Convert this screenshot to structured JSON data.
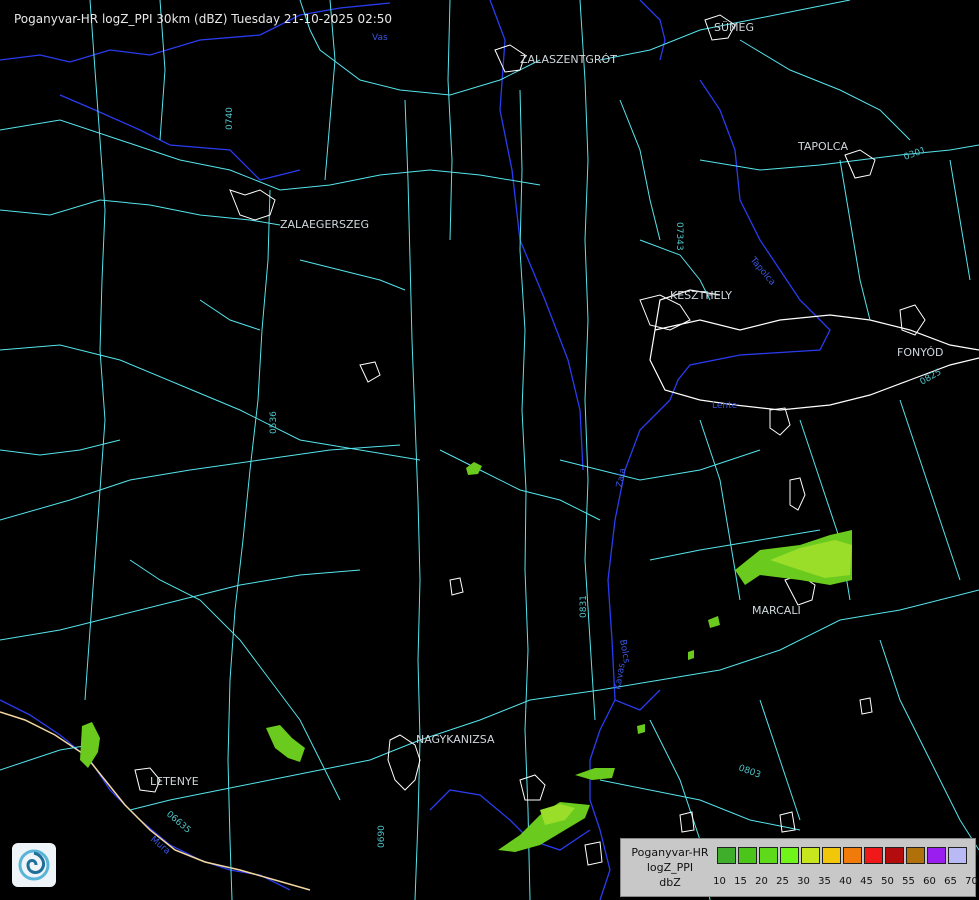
{
  "header": {
    "title": "Poganyvar-HR logZ_PPI 30km (dBZ) Tuesday 21-10-2025 02:50"
  },
  "cities": {
    "sumeg": "SÜMEG",
    "zalaszentgrot": "ZALASZENTGRÓT",
    "tapolca": "TAPOLCA",
    "zalaegerszeg": "ZALAEGERSZEG",
    "keszthely": "KESZTHELY",
    "fonyod": "FONYÓD",
    "marcali": "MARCALI",
    "nagykanizsa": "NAGYKANIZSA",
    "letenye": "LETENYE"
  },
  "road_labels": {
    "r0740": "0740",
    "r07343": "07343",
    "r0536": "0536",
    "r0831": "0831",
    "r0803": "0803",
    "r0635": "06635",
    "r0690": "0690",
    "r0301": "0301",
    "r0825": "0825"
  },
  "river_labels": {
    "vas": "Vas",
    "zala": "Zala",
    "tapolca": "Tapolca",
    "bolcs": "Bolcs",
    "mura": "Mura",
    "kavas": "Kavas",
    "lenti": "Lente"
  },
  "legend": {
    "title_lines": [
      "Poganyvar-HR",
      "logZ_PPI",
      "dbZ"
    ],
    "colors": [
      "#3fae2a",
      "#4cc51a",
      "#5ddb1a",
      "#6ff51a",
      "#c8e61e",
      "#f2c70a",
      "#f07a0a",
      "#f01818",
      "#b40c0c",
      "#b0700a",
      "#9a1ef0",
      "#b9b9f5"
    ],
    "ticks": [
      "10",
      "15",
      "20",
      "25",
      "30",
      "35",
      "40",
      "45",
      "50",
      "55",
      "60",
      "65",
      "70"
    ]
  },
  "colors": {
    "roads": "#55e5ec",
    "rivers": "#2a3cf0",
    "lake": "#ffffff",
    "border": "#f2d7a0",
    "precip_light": "#6acb1e",
    "precip_mid": "#9ade2a"
  }
}
